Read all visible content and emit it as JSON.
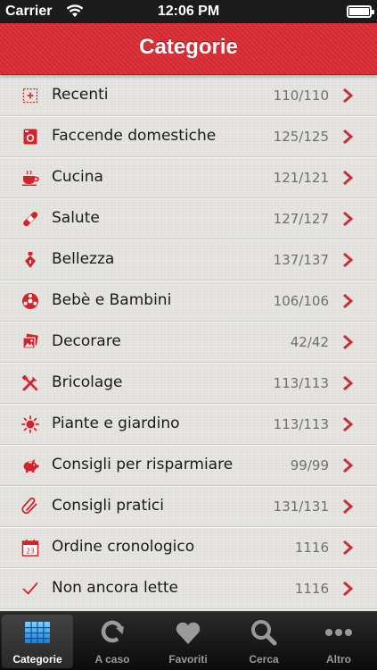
{
  "status_bar": {
    "carrier": "Carrier",
    "time": "12:06 PM"
  },
  "nav": {
    "title": "Categorie"
  },
  "colors": {
    "accent": "#d92b33",
    "icon_red": "#d5232b",
    "chevron": "#c4313a"
  },
  "categories": [
    {
      "label": "Recenti",
      "count": "110/110",
      "icon": "recent-icon"
    },
    {
      "label": "Faccende domestiche",
      "count": "125/125",
      "icon": "washing-machine-icon"
    },
    {
      "label": "Cucina",
      "count": "121/121",
      "icon": "cup-icon"
    },
    {
      "label": "Salute",
      "count": "127/127",
      "icon": "bandage-icon"
    },
    {
      "label": "Bellezza",
      "count": "137/137",
      "icon": "perfume-icon"
    },
    {
      "label": "Bebè e Bambini",
      "count": "106/106",
      "icon": "ball-icon"
    },
    {
      "label": "Decorare",
      "count": "42/42",
      "icon": "picture-icon"
    },
    {
      "label": "Bricolage",
      "count": "113/113",
      "icon": "tools-icon"
    },
    {
      "label": "Piante e giardino",
      "count": "113/113",
      "icon": "sun-icon"
    },
    {
      "label": "Consigli per risparmiare",
      "count": "99/99",
      "icon": "piggy-bank-icon"
    },
    {
      "label": "Consigli pratici",
      "count": "131/131",
      "icon": "paperclip-icon"
    },
    {
      "label": "Ordine cronologico",
      "count": "1116",
      "icon": "calendar-icon"
    },
    {
      "label": "Non ancora lette",
      "count": "1116",
      "icon": "checkmark-icon"
    }
  ],
  "calendar_day": "23",
  "tabs": [
    {
      "label": "Categorie",
      "icon": "grid-icon",
      "active": true
    },
    {
      "label": "A caso",
      "icon": "refresh-icon",
      "active": false
    },
    {
      "label": "Favoriti",
      "icon": "heart-icon",
      "active": false
    },
    {
      "label": "Cerca",
      "icon": "search-icon",
      "active": false
    },
    {
      "label": "Altro",
      "icon": "more-icon",
      "active": false
    }
  ]
}
